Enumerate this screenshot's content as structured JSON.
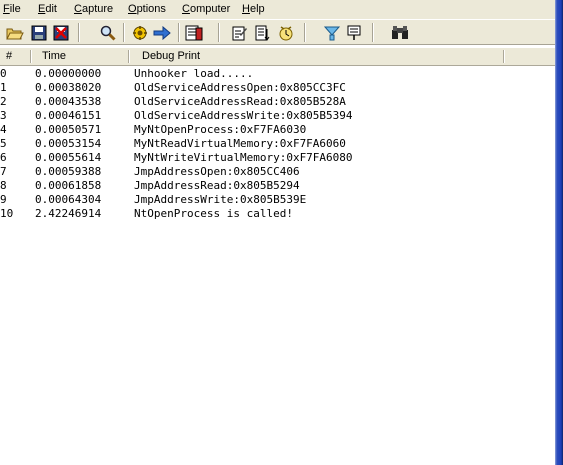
{
  "menu": [
    {
      "label": "File",
      "key": "F",
      "rest": "ile"
    },
    {
      "label": "Edit",
      "key": "E",
      "rest": "dit"
    },
    {
      "label": "Capture",
      "key": "C",
      "rest": "apture"
    },
    {
      "label": "Options",
      "key": "O",
      "rest": "ptions"
    },
    {
      "label": "Computer",
      "key": "C",
      "rest": "omputer"
    },
    {
      "label": "Help",
      "key": "H",
      "rest": "elp"
    }
  ],
  "toolbar": {
    "buttons": [
      "open-icon",
      "save-icon",
      "clear-icon",
      "find-icon",
      "capture-icon",
      "autoscroll-icon",
      "history-icon",
      "options-icon",
      "filter-icon",
      "clock-icon",
      "highlight-icon",
      "pin-icon",
      "binoculars-icon"
    ]
  },
  "columns": {
    "num": "#",
    "time": "Time",
    "debug": "Debug Print"
  },
  "rows": [
    {
      "num": "0",
      "time": "0.00000000",
      "msg": "Unhooker load....."
    },
    {
      "num": "1",
      "time": "0.00038020",
      "msg": "OldServiceAddressOpen:0x805CC3FC"
    },
    {
      "num": "2",
      "time": "0.00043538",
      "msg": "OldServiceAddressRead:0x805B528A"
    },
    {
      "num": "3",
      "time": "0.00046151",
      "msg": "OldServiceAddressWrite:0x805B5394"
    },
    {
      "num": "4",
      "time": "0.00050571",
      "msg": "MyNtOpenProcess:0xF7FA6030"
    },
    {
      "num": "5",
      "time": "0.00053154",
      "msg": "MyNtReadVirtualMemory:0xF7FA6060"
    },
    {
      "num": "6",
      "time": "0.00055614",
      "msg": "MyNtWriteVirtualMemory:0xF7FA6080"
    },
    {
      "num": "7",
      "time": "0.00059388",
      "msg": "JmpAddressOpen:0x805CC406"
    },
    {
      "num": "8",
      "time": "0.00061858",
      "msg": "JmpAddressRead:0x805B5294"
    },
    {
      "num": "9",
      "time": "0.00064304",
      "msg": "JmpAddressWrite:0x805B539E"
    },
    {
      "num": "10",
      "time": "2.42246914",
      "msg": "NtOpenProcess is called!"
    }
  ]
}
